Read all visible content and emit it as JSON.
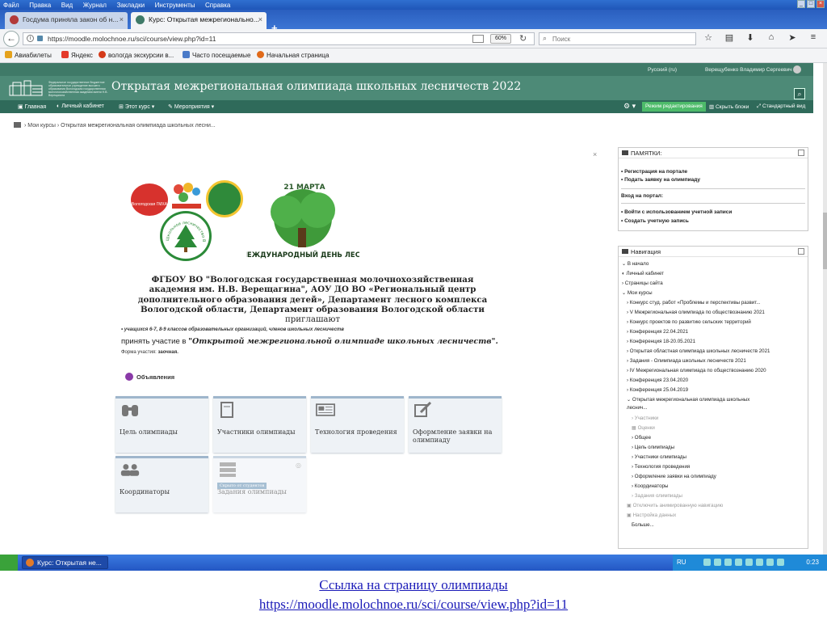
{
  "browser": {
    "menu": [
      "Файл",
      "Правка",
      "Вид",
      "Журнал",
      "Закладки",
      "Инструменты",
      "Справка"
    ],
    "tabs": [
      {
        "title": "Госдума приняла закон об н...",
        "active": false
      },
      {
        "title": "Курс: Открытая межрегионально...",
        "active": true
      }
    ],
    "url": "https://moodle.molochnoe.ru/sci/course/view.php?id=11",
    "zoom": "60%",
    "search_placeholder": "Поиск",
    "bookmarks": [
      "Авиабилеты",
      "Яндекс",
      "вологда экскурсии в...",
      "Часто посещаемые",
      "Начальная страница"
    ]
  },
  "moodle": {
    "language": "Русский (ru)",
    "user": "Верещубенко Владимир Сергеевич",
    "logo_text": "Федеральное государственное бюджетное образовательное учреждение высшего образования Вологодская государственная молочнохозяйственная академия имени Н.В. Верещагина",
    "site_name": "Открытая межрегиональная олимпиада школьных лесничеств 2022",
    "menu": [
      "Главная",
      "Личный кабинет",
      "Этот курс",
      "Мероприятия"
    ],
    "edit_mode": "Режим редактирования",
    "hide_blocks": "Скрыть блоки",
    "standard_view": "Стандартный вид",
    "breadcrumb": [
      "Мои курсы",
      "Открытая межрегиональная олимпиада школьных лесни..."
    ],
    "logos": {
      "vgmha": "Вологодская ГМХА",
      "ring_text": "Школьное лесничество Вологодская область",
      "march_date": "21 МАРТА",
      "forest_day": "МЕЖДУНАРОДНЫЙ ДЕНЬ ЛЕСА"
    },
    "intro_lines": [
      "ФГБОУ ВО \"Вологодская государственная молочнохозяйственная",
      "академия им. Н.В. Верещагина\", АОУ ДО ВО «Региональный центр",
      "дополнительного образования детей», Департамент лесного комплекса",
      "Вологодской области, Департамент образования Вологодской области",
      "приглашают"
    ],
    "participants_note": "учащихся 6-7, 8-9 классов образовательных организаций, членов школьных лесничеств",
    "invite_prefix": "принять участие в ",
    "invite_name": "\"Открытой межрегиональной олимпиаде школьных лесничеств\".",
    "form_label": "Форма участия: ",
    "form_value": "заочная.",
    "announcements": "Объявления",
    "tiles": [
      {
        "label": "Цель олимпиады",
        "icon": "binoculars-icon"
      },
      {
        "label": "Участники олимпиады",
        "icon": "document-icon"
      },
      {
        "label": "Технология проведения",
        "icon": "newspaper-icon"
      },
      {
        "label": "Оформление заявки на олимпиаду",
        "icon": "pencil-icon"
      },
      {
        "label": "Координаторы",
        "icon": "users-icon"
      },
      {
        "label": "Задания олимпиады",
        "icon": "server-icon",
        "hidden_badge": "Скрыто от студентов"
      }
    ],
    "notes_block": {
      "title": "ПАМЯТКИ:",
      "links": [
        "Регистрация на портале",
        "Подать заявку на олимпиаду"
      ],
      "login_heading": "Вход на портал:",
      "login_links": [
        "Войти с использованием учетной записи",
        "Создать учетную запись"
      ]
    },
    "nav_block": {
      "title": "Навигация",
      "items": [
        "В начало",
        "Личный кабинет",
        "Страницы сайта",
        "Мои курсы",
        "Конкурс студ. работ «Проблемы и перспективы развит...",
        "V Межрегиональная олимпиада по обществознанию 2021",
        "Конкурс проектов по развитию сельских территорий",
        "Конференция 22.04.2021",
        "Конференция 18-20.05.2021",
        "Открытая областная олимпиада школьных лесничеств 2021",
        "Задания - Олимпиада школьных лесничеств 2021",
        "IV Межрегиональная олимпиада по обществознанию 2020",
        "Конференция 23.04.2020",
        "Конференция 25.04.2019",
        "Открытая межрегиональная олимпиада школьных",
        "леснич...",
        "Участники",
        "Оценки",
        "Общее",
        "Цель олимпиады",
        "Участники олимпиады",
        "Технология проведения",
        "Оформление заявки на олимпиаду",
        "Координаторы",
        "Задания олимпиады",
        "Отключить анимированную навигацию",
        "Настройка данных",
        "Больше..."
      ]
    }
  },
  "taskbar": {
    "window": "Курс: Открытая не...",
    "language": "RU",
    "clock": "0:23"
  },
  "caption": {
    "title": "Ссылка на страницу олимпиады",
    "url": "https://moodle.molochnoe.ru/sci/course/view.php?id=11"
  }
}
